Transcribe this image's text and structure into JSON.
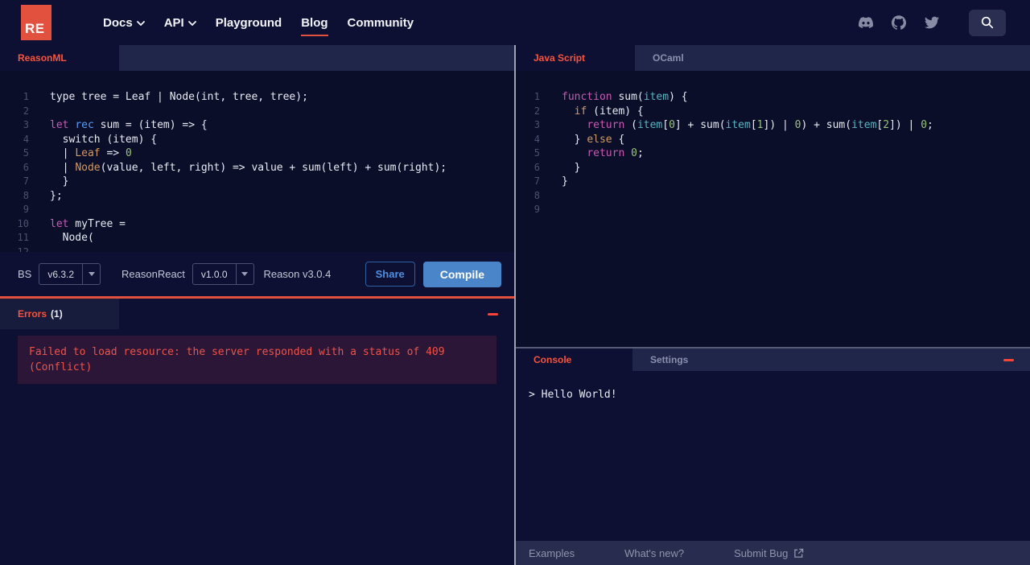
{
  "colors": {
    "accent_red": "#f6543f",
    "logo_red": "#e2513e",
    "compile_blue": "#4a85c9",
    "share_blue": "#4f8ee0",
    "error_box_bg": "#2b1638"
  },
  "navbar": {
    "logo": "RE",
    "items": [
      {
        "label": "Docs"
      },
      {
        "label": "API"
      },
      {
        "label": "Playground"
      },
      {
        "label": "Blog"
      },
      {
        "label": "Community"
      }
    ]
  },
  "left_editor": {
    "tab_label": "ReasonML",
    "line_count": 18,
    "lines": [
      [
        [
          "plain",
          "type tree = Leaf | Node(int, tree, tree);"
        ]
      ],
      [],
      [
        [
          "kw",
          "let "
        ],
        [
          "blue",
          "rec"
        ],
        [
          "plain",
          " sum = (item) => {"
        ]
      ],
      [
        [
          "plain",
          "  switch (item) {"
        ]
      ],
      [
        [
          "plain",
          "  | "
        ],
        [
          "orange",
          "Leaf"
        ],
        [
          "plain",
          " => "
        ],
        [
          "green",
          "0"
        ]
      ],
      [
        [
          "plain",
          "  | "
        ],
        [
          "orange",
          "Node"
        ],
        [
          "plain",
          "(value, left, right) => value + sum(left) + sum(right);"
        ]
      ],
      [
        [
          "plain",
          "  }"
        ]
      ],
      [
        [
          "plain",
          "};"
        ]
      ],
      [],
      [
        [
          "kw",
          "let"
        ],
        [
          "plain",
          " myTree ="
        ]
      ],
      [
        [
          "plain",
          "  Node("
        ]
      ],
      [],
      [],
      [],
      [],
      [],
      [],
      []
    ]
  },
  "toolbar": {
    "bs_label": "BS",
    "bs_version": "v6.3.2",
    "reasonreact_label": "ReasonReact",
    "reasonreact_version": "v1.0.0",
    "reason_version": "Reason v3.0.4",
    "share_label": "Share",
    "compile_label": "Compile"
  },
  "errors_panel": {
    "title": "Errors",
    "count": "(1)",
    "message": "Failed to load resource: the server responded with a status of 409\n(Conflict)"
  },
  "right_editor": {
    "tabs": [
      {
        "label": "Java Script"
      },
      {
        "label": "OCaml"
      }
    ],
    "line_count": 9,
    "lines": [
      [
        [
          "kw",
          "function"
        ],
        [
          "plain",
          " sum("
        ],
        [
          "teal",
          "item"
        ],
        [
          "plain",
          ") {"
        ]
      ],
      [
        [
          "plain",
          "  "
        ],
        [
          "orange",
          "if"
        ],
        [
          "plain",
          " (item) {"
        ]
      ],
      [
        [
          "plain",
          "    "
        ],
        [
          "kw",
          "return"
        ],
        [
          "plain",
          " ("
        ],
        [
          "teal",
          "item"
        ],
        [
          "plain",
          "["
        ],
        [
          "green",
          "0"
        ],
        [
          "plain",
          "] + sum("
        ],
        [
          "teal",
          "item"
        ],
        [
          "plain",
          "["
        ],
        [
          "green",
          "1"
        ],
        [
          "plain",
          "]) | "
        ],
        [
          "green",
          "0"
        ],
        [
          "plain",
          ") + sum("
        ],
        [
          "teal",
          "item"
        ],
        [
          "plain",
          "["
        ],
        [
          "green",
          "2"
        ],
        [
          "plain",
          "]) | "
        ],
        [
          "green",
          "0"
        ],
        [
          "plain",
          ";"
        ]
      ],
      [
        [
          "plain",
          "  } "
        ],
        [
          "orange",
          "else"
        ],
        [
          "plain",
          " {"
        ]
      ],
      [
        [
          "plain",
          "    "
        ],
        [
          "kw",
          "return"
        ],
        [
          "plain",
          " "
        ],
        [
          "green",
          "0"
        ],
        [
          "plain",
          ";"
        ]
      ],
      [
        [
          "plain",
          "  }"
        ]
      ],
      [
        [
          "plain",
          "}"
        ]
      ],
      [],
      []
    ]
  },
  "console_panel": {
    "tabs": [
      {
        "label": "Console"
      },
      {
        "label": "Settings"
      }
    ],
    "output": "> Hello World!"
  },
  "footer": {
    "links": [
      {
        "label": "Examples"
      },
      {
        "label": "What's new?"
      },
      {
        "label": "Submit Bug"
      }
    ]
  }
}
